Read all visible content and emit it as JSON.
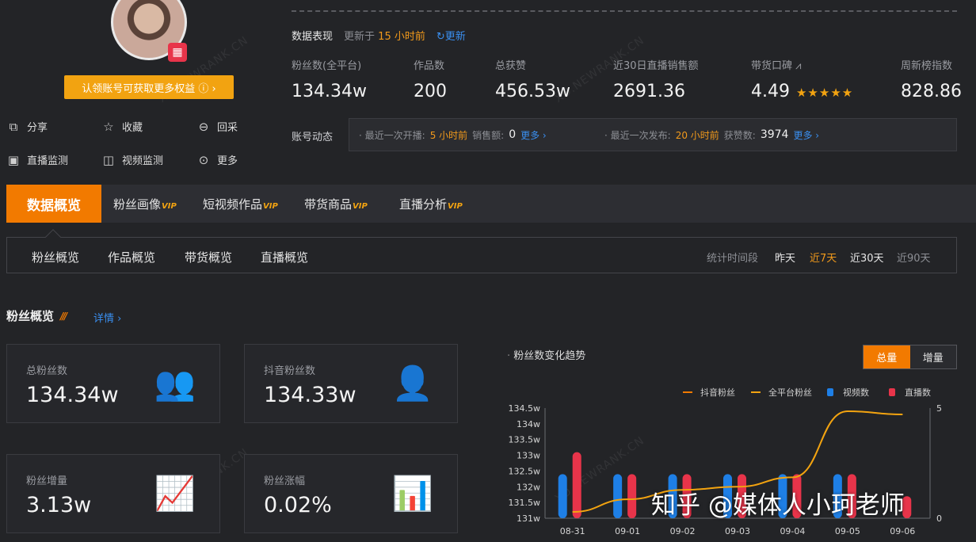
{
  "profile": {
    "claim_button": "认领账号可获取更多权益 ⓘ ›",
    "actions": [
      "分享",
      "收藏",
      "回采",
      "直播监测",
      "视频监测",
      "更多"
    ]
  },
  "performance": {
    "title": "数据表现",
    "updated_prefix": "更新于",
    "updated_value": "15 小时前",
    "refresh": "更新"
  },
  "stats": [
    {
      "label": "粉丝数(全平台)",
      "value": "134.34w"
    },
    {
      "label": "作品数",
      "value": "200"
    },
    {
      "label": "总获赞",
      "value": "456.53w"
    },
    {
      "label": "近30日直播销售额",
      "value": "2691.36"
    },
    {
      "label": "带货口碑",
      "value": "4.49",
      "rating": 4.49,
      "rating_max": 5
    },
    {
      "label": "周新榜指数",
      "value": "828.86"
    }
  ],
  "dynamics": {
    "label": "账号动态",
    "live_prefix": "· 最近一次开播:",
    "live_value": "5 小时前",
    "sales_label": "销售额:",
    "sales_value": "0",
    "more1": "更多 ›",
    "publish_prefix": "· 最近一次发布:",
    "publish_value": "20 小时前",
    "likes_label": "获赞数:",
    "likes_value": "3974",
    "more2": "更多 ›"
  },
  "main_tabs": [
    {
      "label": "数据概览",
      "vip": ""
    },
    {
      "label": "粉丝画像",
      "vip": "VIP"
    },
    {
      "label": "短视频作品",
      "vip": "VIP"
    },
    {
      "label": "带货商品",
      "vip": "VIP"
    },
    {
      "label": "直播分析",
      "vip": "VIP"
    }
  ],
  "sub_tabs": [
    "粉丝概览",
    "作品概览",
    "带货概览",
    "直播概览"
  ],
  "period": {
    "label": "统计时间段",
    "options": [
      "昨天",
      "近7天",
      "近30天",
      "近90天"
    ],
    "selected": "近7天"
  },
  "fans_section": {
    "title": "粉丝概览",
    "detail": "详情 ›"
  },
  "cards": [
    {
      "label": "总粉丝数",
      "value": "134.34w"
    },
    {
      "label": "抖音粉丝数",
      "value": "134.33w"
    },
    {
      "label": "粉丝增量",
      "value": "3.13w"
    },
    {
      "label": "粉丝涨幅",
      "value": "0.02%"
    }
  ],
  "chart_toggle": {
    "on": "总量",
    "off": "增量"
  },
  "watermark_text": "XD.NEWRANK.CN",
  "zhihu_watermark": "知乎 @媒体人小珂老师",
  "colors": {
    "accent": "#f27a00",
    "star": "#f2a311",
    "link": "#3a8ff0",
    "video_bar": "#1e7fe6",
    "live_bar": "#e8344a",
    "line": "#f2a311"
  },
  "chart_data": {
    "type": "line",
    "title": "粉丝数变化趋势",
    "categories": [
      "08-31",
      "09-01",
      "09-02",
      "09-03",
      "09-04",
      "09-05",
      "09-06"
    ],
    "y_left": {
      "ticks": [
        "131w",
        "131.5w",
        "132w",
        "132.5w",
        "133w",
        "133.5w",
        "134w",
        "134.5w"
      ],
      "range": [
        131,
        134.5
      ]
    },
    "y_right": {
      "ticks": [
        "0",
        "5"
      ],
      "range": [
        0,
        5
      ]
    },
    "legend": [
      "抖音粉丝",
      "全平台粉丝",
      "视频数",
      "直播数"
    ],
    "legend_position": "top-right",
    "series": [
      {
        "name": "抖音粉丝",
        "type": "line",
        "axis": "left",
        "values": [
          131.2,
          131.6,
          131.9,
          132.0,
          132.3,
          134.4,
          134.3
        ]
      },
      {
        "name": "全平台粉丝",
        "type": "line",
        "axis": "left",
        "values": [
          131.2,
          131.6,
          131.9,
          132.0,
          132.3,
          134.4,
          134.3
        ]
      },
      {
        "name": "视频数",
        "type": "bar",
        "axis": "right",
        "values": [
          2,
          2,
          2,
          2,
          2,
          2,
          0
        ]
      },
      {
        "name": "直播数",
        "type": "bar",
        "axis": "right",
        "values": [
          3,
          2,
          2,
          2,
          2,
          2,
          1
        ]
      }
    ]
  }
}
